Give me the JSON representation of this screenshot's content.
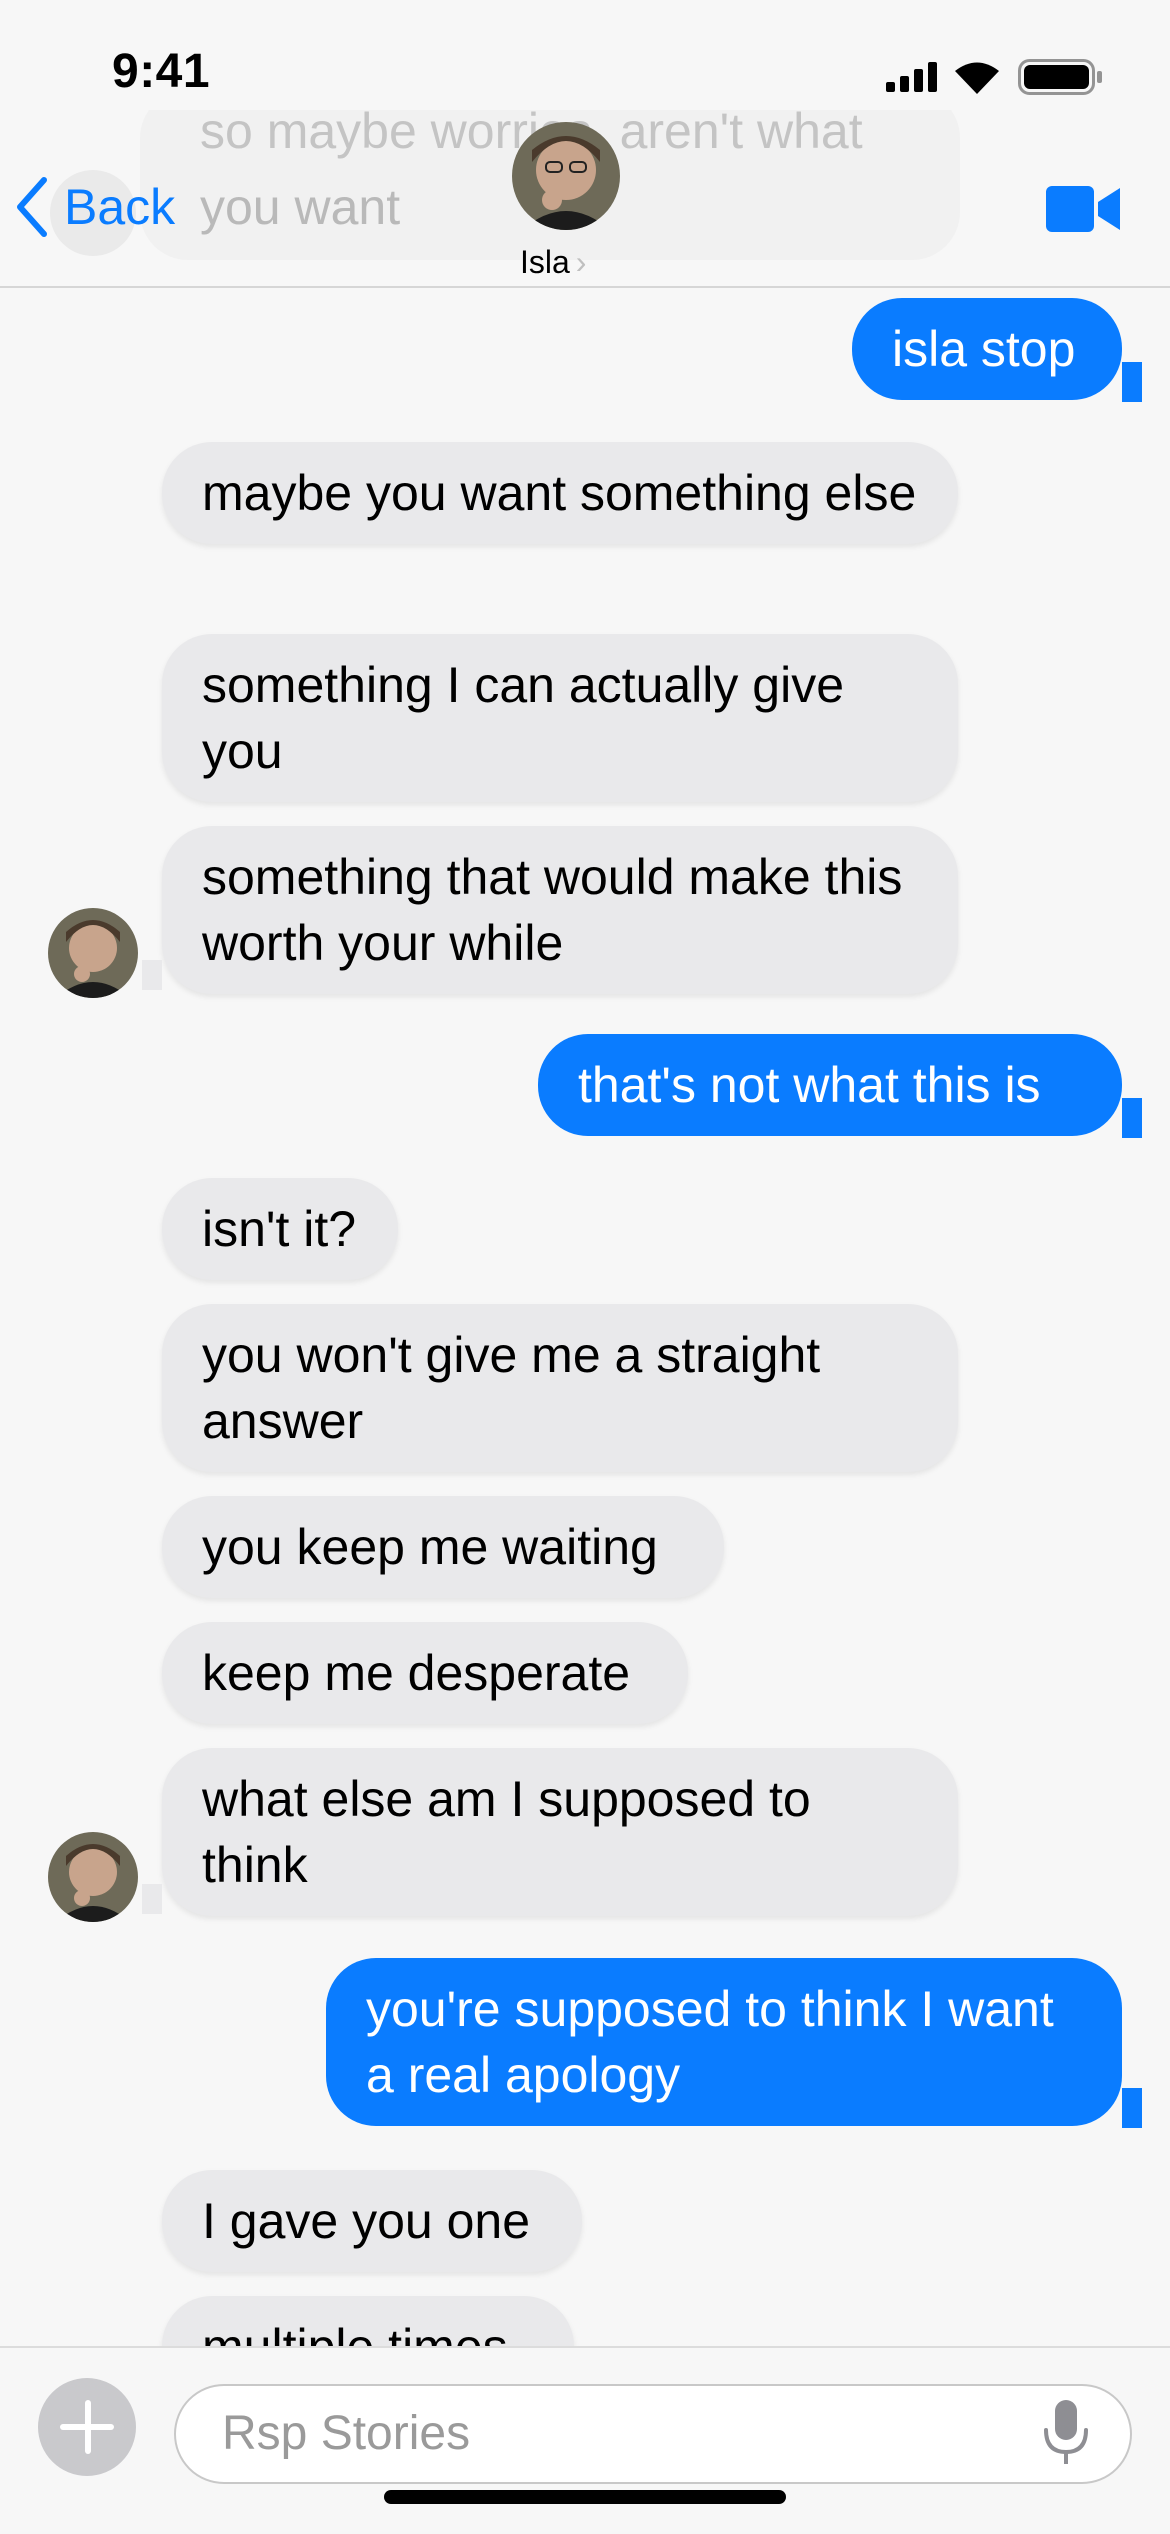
{
  "status_bar": {
    "time": "9:41"
  },
  "header": {
    "back_label": "Back",
    "contact_name": "Isla",
    "peek_text_line1": "so maybe worries, aren't what",
    "peek_text_line2": "you want"
  },
  "messages": [
    {
      "dir": "out",
      "text": "isla stop"
    },
    {
      "dir": "in",
      "text": "maybe you want something else"
    },
    {
      "dir": "in",
      "text": "something I can actually give you"
    },
    {
      "dir": "in",
      "text": "something that would make this worth your while"
    },
    {
      "dir": "out",
      "text": "that's not what this is"
    },
    {
      "dir": "in",
      "text": "isn't it?"
    },
    {
      "dir": "in",
      "text": "you won't give me a straight answer"
    },
    {
      "dir": "in",
      "text": "you keep me waiting"
    },
    {
      "dir": "in",
      "text": "keep me desperate"
    },
    {
      "dir": "in",
      "text": "what else am I supposed to think"
    },
    {
      "dir": "out",
      "text": "you're supposed to think I want a real apology"
    },
    {
      "dir": "in",
      "text": "I gave you one"
    },
    {
      "dir": "in",
      "text": "multiple times"
    }
  ],
  "composer": {
    "placeholder": "Rsp Stories"
  },
  "colors": {
    "accent": "#0a7cff",
    "incoming_bubble": "#e9e9eb",
    "background": "#f7f7f7"
  },
  "icons": [
    "signal-icon",
    "wifi-icon",
    "battery-icon",
    "chevron-left-icon",
    "video-call-icon",
    "plus-icon",
    "microphone-icon"
  ]
}
